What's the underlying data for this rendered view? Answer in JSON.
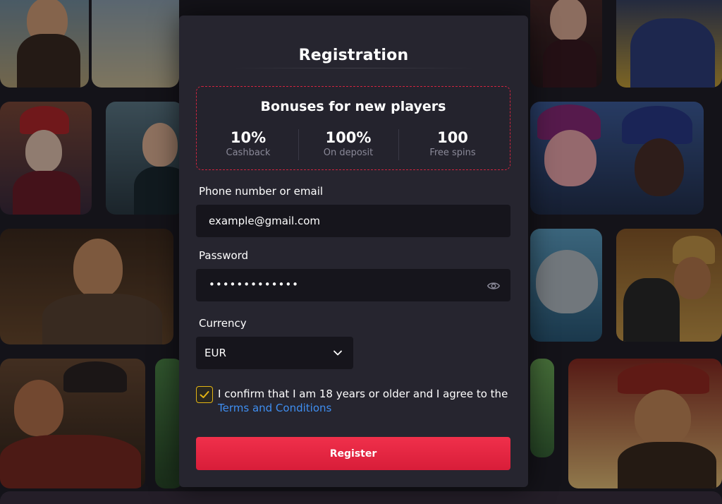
{
  "modal": {
    "title": "Registration"
  },
  "bonuses": {
    "title": "Bonuses for new players",
    "items": [
      {
        "value": "10%",
        "label": "Cashback"
      },
      {
        "value": "100%",
        "label": "On deposit"
      },
      {
        "value": "100",
        "label": "Free spins"
      }
    ],
    "border_color": "#d0243f"
  },
  "form": {
    "contact_label": "Phone number or email",
    "contact_value": "example@gmail.com",
    "password_label": "Password",
    "password_mask": "•••••••••••••",
    "currency_label": "Currency",
    "currency_value": "EUR",
    "confirm_text": "I confirm that I am 18 years or older and I agree to the",
    "terms_link": "Terms and Conditions",
    "checkbox_checked": true,
    "register_label": "Register"
  },
  "icons": {
    "password_toggle": "eye-icon",
    "currency_dropdown": "chevron-down-icon",
    "checkbox": "check-icon"
  },
  "colors": {
    "accent_red": "#e82a45",
    "link_blue": "#3f8ef0",
    "checkbox_gold": "#e3b414",
    "panel": "#26252f",
    "input": "#16151c"
  }
}
